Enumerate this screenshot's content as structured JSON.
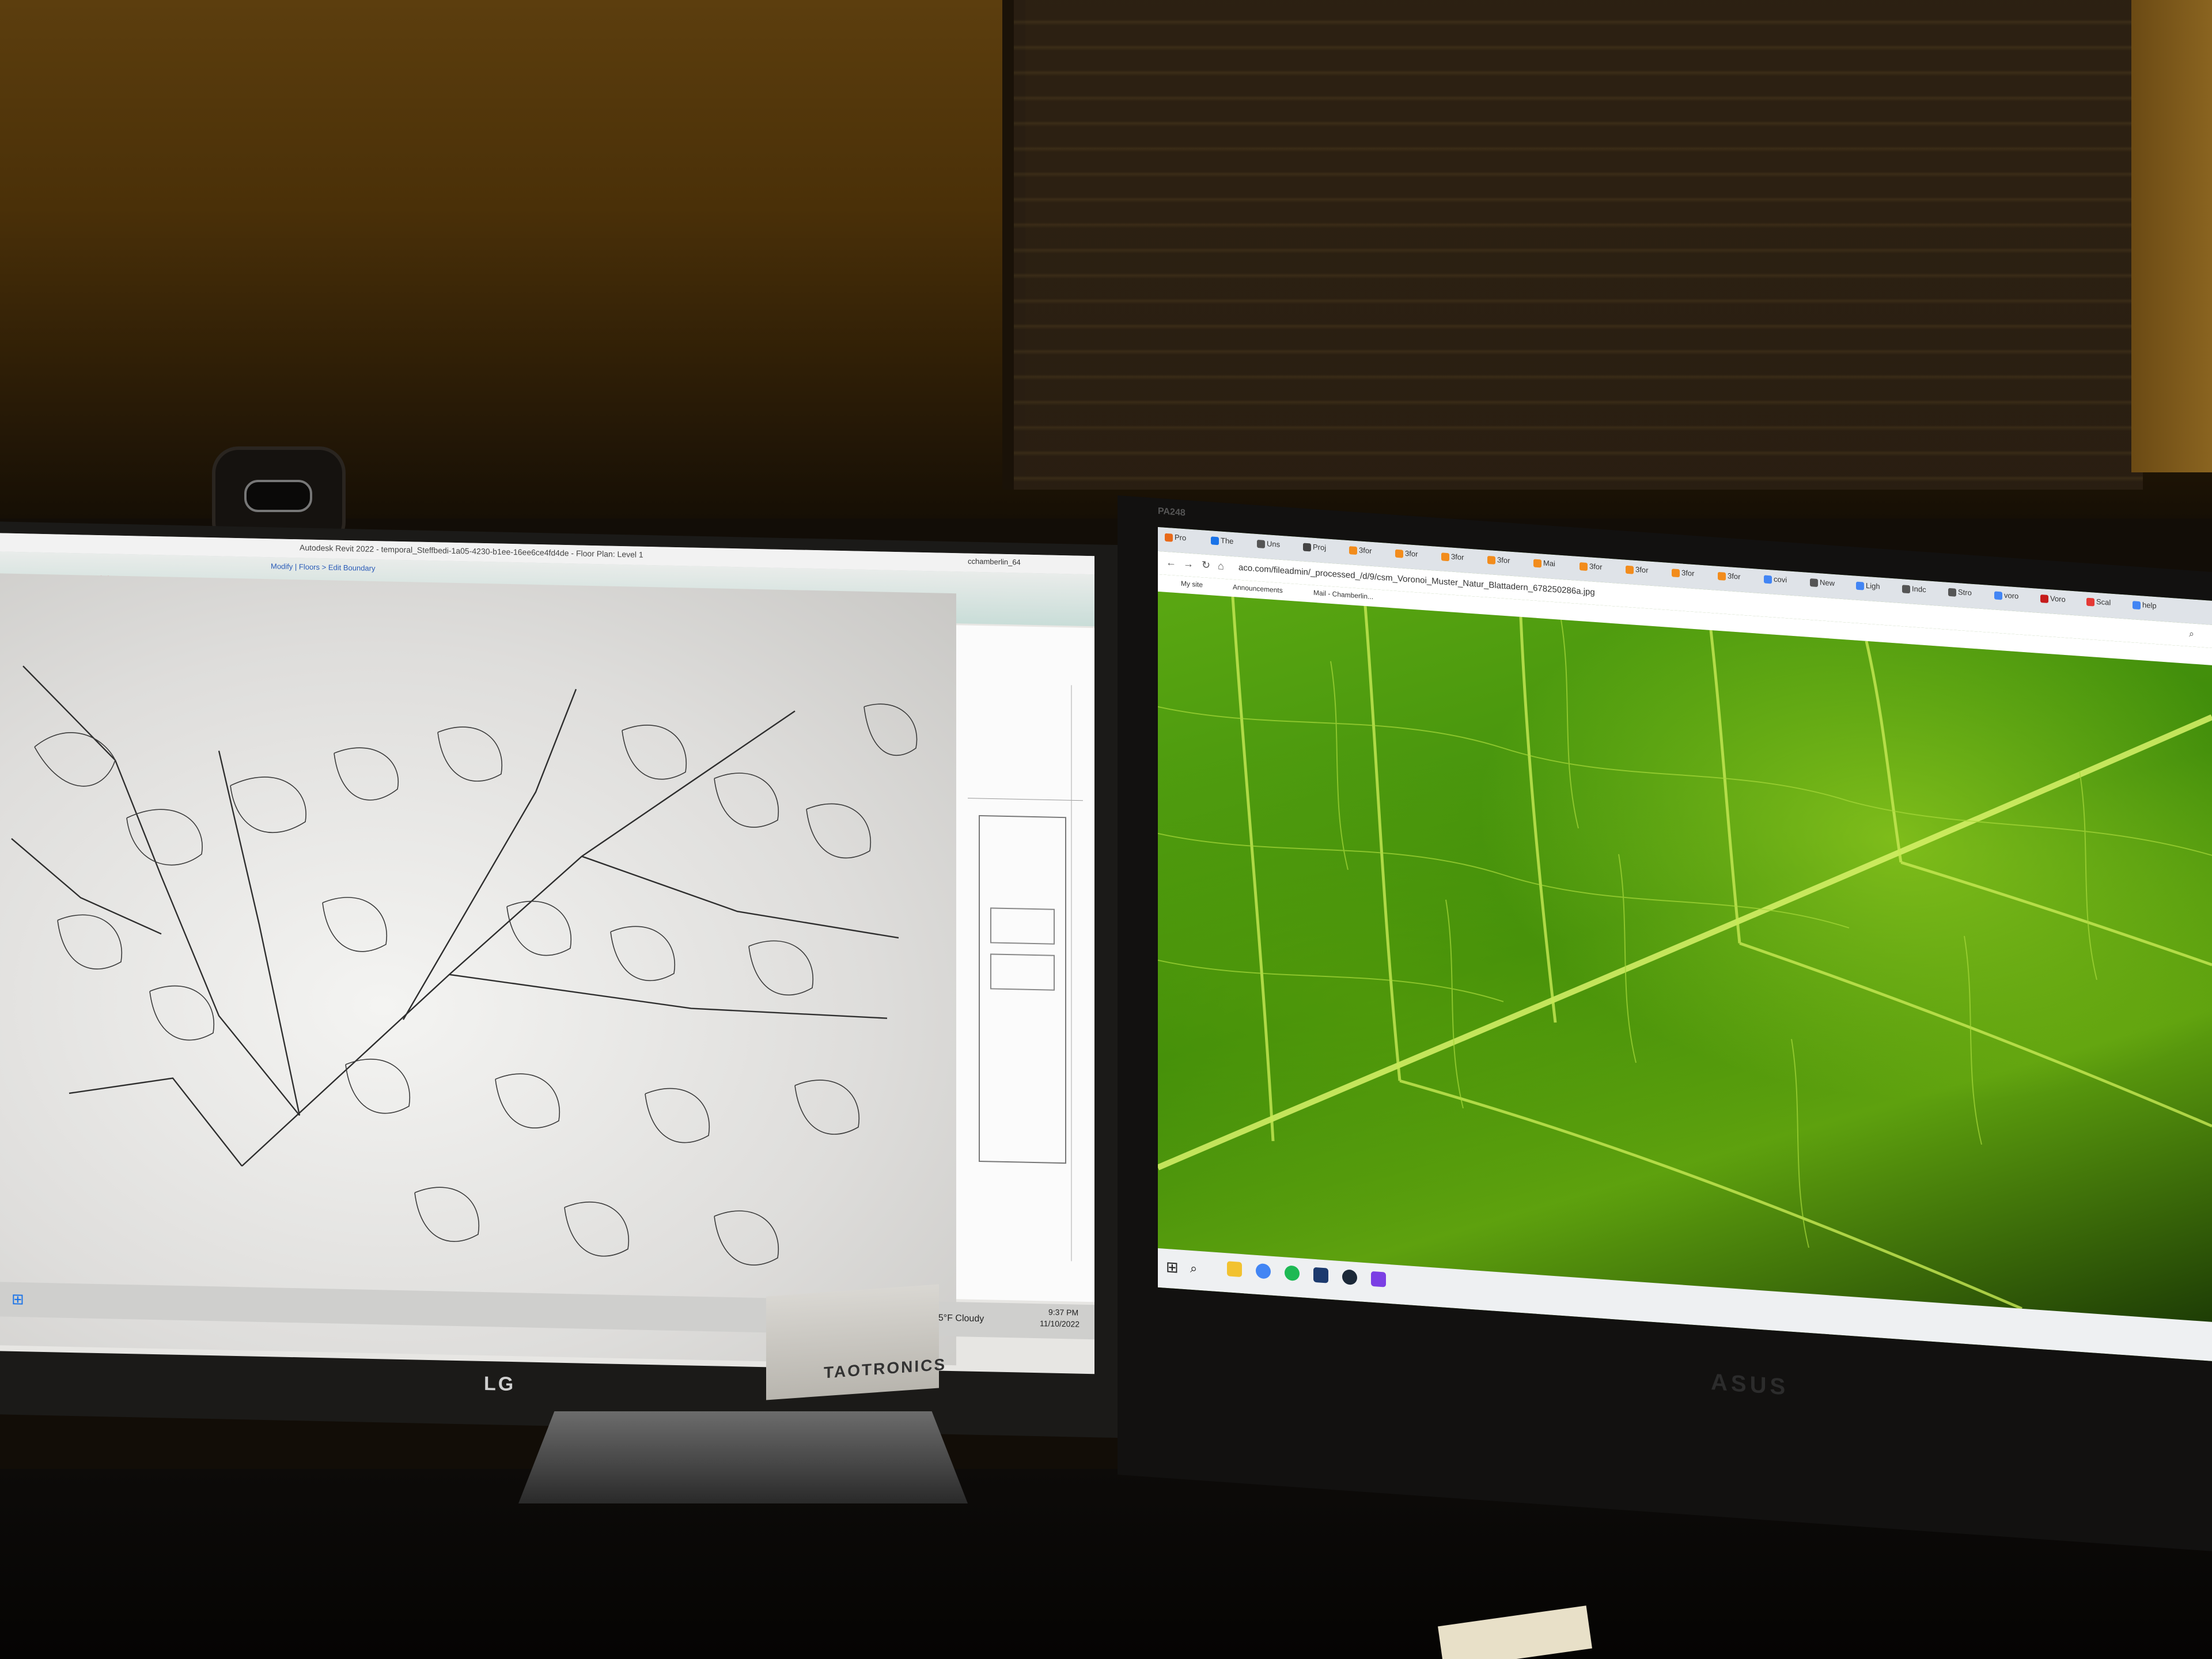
{
  "left_monitor": {
    "window_title": "Autodesk Revit 2022 - temporal_Steffbedi-1a05-4230-b1ee-16ee6ce4fd4de - Floor Plan: Level 1",
    "breadcrumb": "Modify | Floors > Edit Boundary",
    "user": "cchamberlin_64",
    "weather": "55°F Cloudy",
    "clock_time": "9:37 PM",
    "clock_date": "11/10/2022",
    "bezel_brand": "LG",
    "speaker_brand": "TAOTRONICS"
  },
  "right_monitor": {
    "url": "aco.com/fileadmin/_processed_/d/9/csm_Voronoi_Muster_Natur_Blattadern_678250286a.jpg",
    "tabs": [
      {
        "label": "Pro",
        "color": "#e86a1a"
      },
      {
        "label": "The",
        "color": "#1a73e8"
      },
      {
        "label": "Uns",
        "color": "#555555"
      },
      {
        "label": "Proj",
        "color": "#444444"
      },
      {
        "label": "3for",
        "color": "#f28c1c"
      },
      {
        "label": "3for",
        "color": "#f28c1c"
      },
      {
        "label": "3for",
        "color": "#f28c1c"
      },
      {
        "label": "3for",
        "color": "#f28c1c"
      },
      {
        "label": "Mai",
        "color": "#f28c1c"
      },
      {
        "label": "3for",
        "color": "#f28c1c"
      },
      {
        "label": "3for",
        "color": "#f28c1c"
      },
      {
        "label": "3for",
        "color": "#f28c1c"
      },
      {
        "label": "3for",
        "color": "#f28c1c"
      },
      {
        "label": "covi",
        "color": "#4285f4"
      },
      {
        "label": "New",
        "color": "#555555"
      },
      {
        "label": "Ligh",
        "color": "#4285f4"
      },
      {
        "label": "Indc",
        "color": "#555555"
      },
      {
        "label": "Stro",
        "color": "#555555"
      },
      {
        "label": "voro",
        "color": "#4285f4"
      },
      {
        "label": "Voro",
        "color": "#c61c1c"
      },
      {
        "label": "Scal",
        "color": "#e53935"
      },
      {
        "label": "help",
        "color": "#4285f4"
      }
    ],
    "bookmarks": [
      "My site",
      "Announcements",
      "Mail - Chamberlin..."
    ],
    "bezel_model": "PA248",
    "bezel_brand": "ASUS"
  },
  "colors": {
    "leaf_light": "#b6e83a",
    "leaf_dark": "#2f6a06",
    "wall": "#5c3e0e",
    "revit_ribbon": "#c9ddd8"
  }
}
